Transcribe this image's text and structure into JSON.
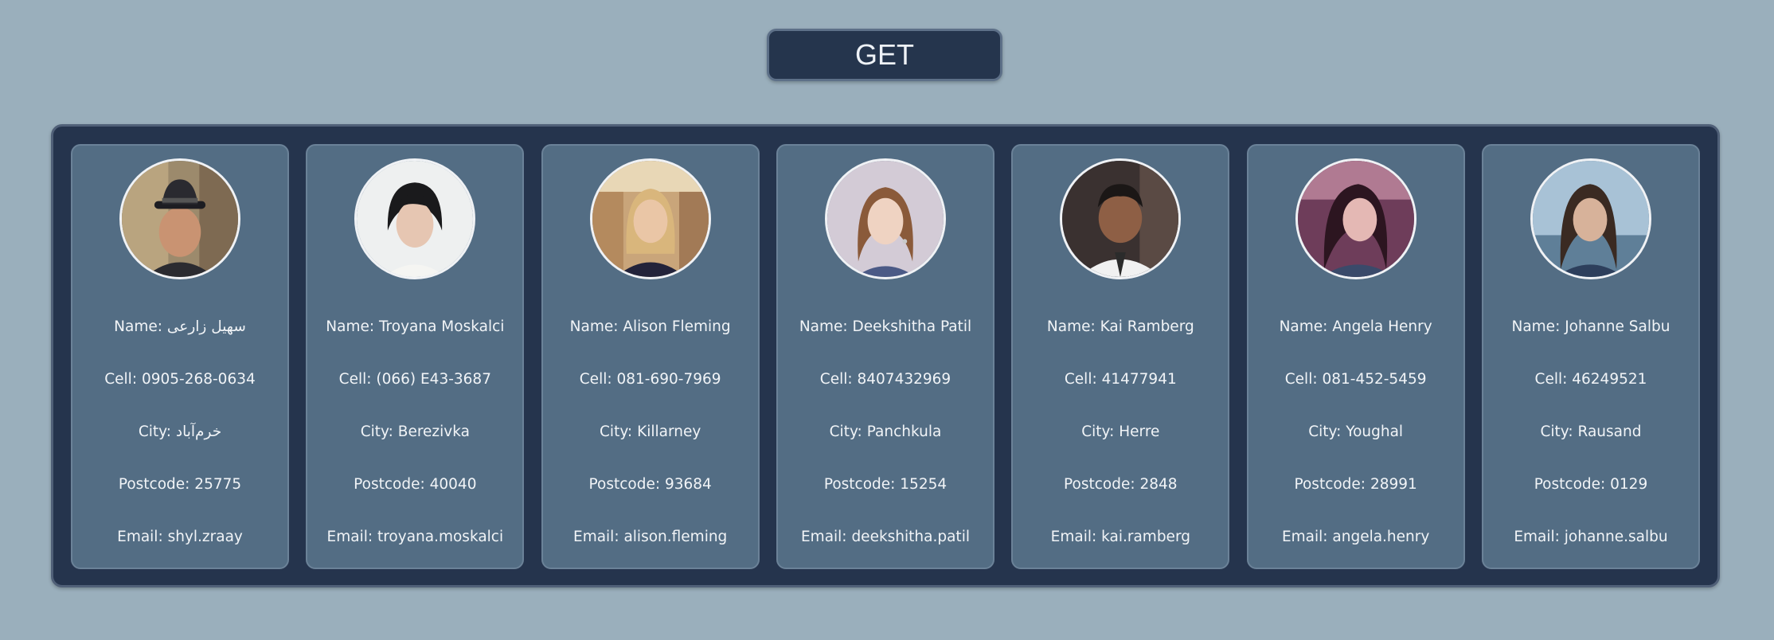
{
  "get_button": {
    "label": "GET"
  },
  "field_labels": {
    "name": "Name:",
    "cell": "Cell:",
    "city": "City:",
    "postcode": "Postcode:",
    "email": "Email:"
  },
  "users": [
    {
      "name": "سهیل زارعی",
      "cell": "0905-268-0634",
      "city": "خرم‌آباد",
      "postcode": "25775",
      "email": "shyl.zraay",
      "avatar": "man-fedora-photo"
    },
    {
      "name": "Troyana Moskalci",
      "cell": "(066) E43-3687",
      "city": "Berezivka",
      "postcode": "40040",
      "email": "troyana.moskalci",
      "avatar": "woman-short-dark-hair-photo"
    },
    {
      "name": "Alison Fleming",
      "cell": "081-690-7969",
      "city": "Killarney",
      "postcode": "93684",
      "email": "alison.fleming",
      "avatar": "woman-blonde-shop-photo"
    },
    {
      "name": "Deekshitha Patil",
      "cell": "8407432969",
      "city": "Panchkula",
      "postcode": "15254",
      "email": "deekshitha.patil",
      "avatar": "woman-curly-hair-photo"
    },
    {
      "name": "Kai Ramberg",
      "cell": "41477941",
      "city": "Herre",
      "postcode": "2848",
      "email": "kai.ramberg",
      "avatar": "man-white-shirt-photo"
    },
    {
      "name": "Angela Henry",
      "cell": "081-452-5459",
      "city": "Youghal",
      "postcode": "28991",
      "email": "angela.henry",
      "avatar": "woman-dark-hair-purple-photo"
    },
    {
      "name": "Johanne Salbu",
      "cell": "46249521",
      "city": "Rausand",
      "postcode": "0129",
      "email": "johanne.salbu",
      "avatar": "woman-seaside-photo"
    }
  ]
}
